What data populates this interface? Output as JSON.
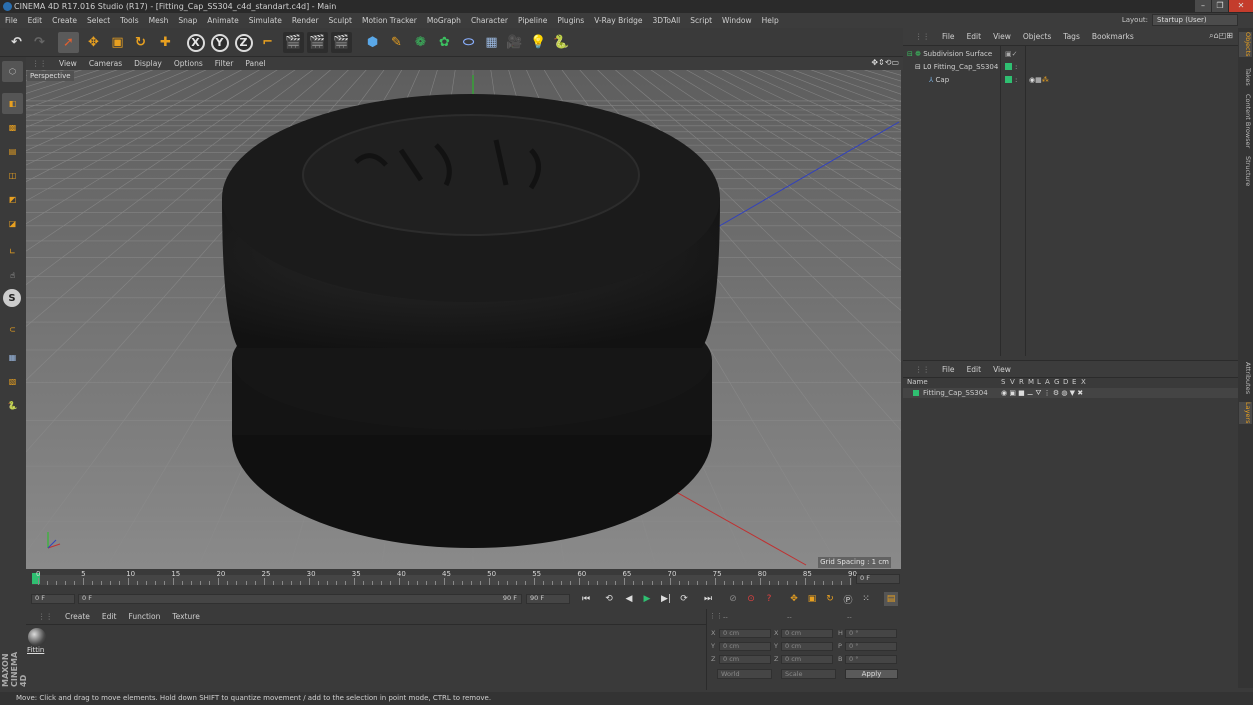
{
  "window": {
    "title": "CINEMA 4D R17.016 Studio (R17) - [Fitting_Cap_SS304_c4d_standart.c4d] - Main",
    "controls": [
      "–",
      "❐",
      "✕"
    ]
  },
  "menu": [
    "File",
    "Edit",
    "Create",
    "Select",
    "Tools",
    "Mesh",
    "Snap",
    "Animate",
    "Simulate",
    "Render",
    "Sculpt",
    "Motion Tracker",
    "MoGraph",
    "Character",
    "Pipeline",
    "Plugins",
    "V-Ray Bridge",
    "3DToAll",
    "Script",
    "Window",
    "Help"
  ],
  "layout": {
    "label": "Layout:",
    "value": "Startup (User)"
  },
  "viewport": {
    "menu": [
      "View",
      "Cameras",
      "Display",
      "Options",
      "Filter",
      "Panel"
    ],
    "camera_label": "Perspective",
    "grid_spacing": "Grid Spacing : 1 cm"
  },
  "objects_panel": {
    "menu": [
      "File",
      "Edit",
      "View",
      "Objects",
      "Tags",
      "Bookmarks"
    ],
    "items": [
      {
        "name": "Subdivision Surface",
        "indent": 0
      },
      {
        "name": "Fitting_Cap_SS304",
        "indent": 1
      },
      {
        "name": "Cap",
        "indent": 2
      }
    ]
  },
  "layers_panel": {
    "menu": [
      "File",
      "Edit",
      "View"
    ],
    "columns": [
      "Name",
      "S",
      "V",
      "R",
      "M",
      "L",
      "A",
      "G",
      "D",
      "E",
      "X"
    ],
    "rows": [
      {
        "name": "Fitting_Cap_SS304"
      }
    ]
  },
  "side_tabs": [
    "Objects",
    "Takes",
    "Content Browser",
    "Structure",
    "Attributes",
    "Layers"
  ],
  "timeline": {
    "ticks": [
      "0",
      "5",
      "10",
      "15",
      "20",
      "25",
      "30",
      "35",
      "40",
      "45",
      "50",
      "55",
      "60",
      "65",
      "70",
      "75",
      "80",
      "85",
      "90"
    ],
    "end_field": "0 F"
  },
  "transport": {
    "start": "0 F",
    "current": "0 F",
    "range_end": "90 F",
    "end": "90 F"
  },
  "materials": {
    "menu": [
      "Create",
      "Edit",
      "Function",
      "Texture"
    ],
    "items": [
      {
        "name": "Fittin"
      }
    ]
  },
  "coordinates": {
    "headers": [
      "--",
      "--",
      "--"
    ],
    "rows": [
      {
        "a_label": "X",
        "a_value": "0 cm",
        "b_label": "X",
        "b_value": "0 cm",
        "c_label": "H",
        "c_value": "0 °"
      },
      {
        "a_label": "Y",
        "a_value": "0 cm",
        "b_label": "Y",
        "b_value": "0 cm",
        "c_label": "P",
        "c_value": "0 °"
      },
      {
        "a_label": "Z",
        "a_value": "0 cm",
        "b_label": "Z",
        "b_value": "0 cm",
        "c_label": "B",
        "c_value": "0 °"
      }
    ],
    "mode_world": "World",
    "mode_scale": "Scale",
    "apply": "Apply"
  },
  "branding": "MAXON CINEMA 4D",
  "status": "Move: Click and drag to move elements. Hold down SHIFT to quantize movement / add to the selection in point mode, CTRL to remove.",
  "colors": {
    "accent_green": "#2fbf71",
    "accent_blue": "#2a6fb0",
    "orange": "#e8a020"
  }
}
